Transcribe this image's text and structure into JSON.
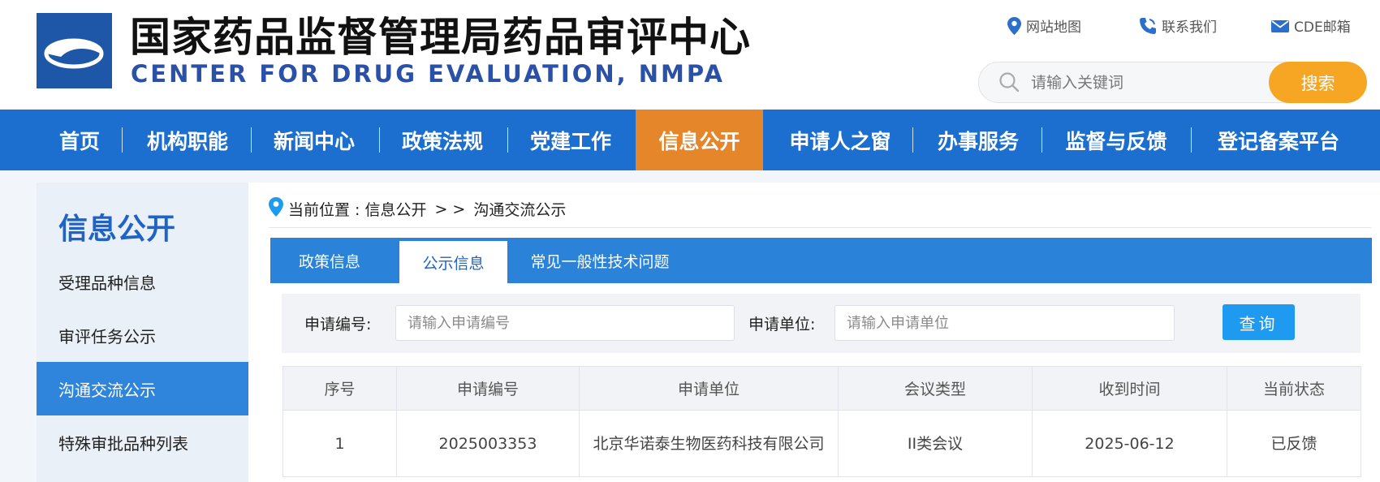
{
  "header": {
    "site_title": "国家药品监督管理局药品审评中心",
    "site_subtitle": "CENTER FOR DRUG EVALUATION, NMPA",
    "top_links": [
      {
        "label": "网站地图",
        "icon": "map-pin-icon"
      },
      {
        "label": "联系我们",
        "icon": "phone-icon"
      },
      {
        "label": "CDE邮箱",
        "icon": "mail-icon"
      }
    ],
    "search": {
      "placeholder": "请输入关键词",
      "value": "",
      "button_label": "搜索"
    }
  },
  "nav": {
    "items": [
      "首页",
      "机构职能",
      "新闻中心",
      "政策法规",
      "党建工作",
      "信息公开",
      "申请人之窗",
      "办事服务",
      "监督与反馈",
      "登记备案平台"
    ],
    "active": "信息公开"
  },
  "sidebar": {
    "title": "信息公开",
    "items": [
      "受理品种信息",
      "审评任务公示",
      "沟通交流公示",
      "特殊审批品种列表"
    ],
    "active": "沟通交流公示"
  },
  "breadcrumb": {
    "prefix": "当前位置 : ",
    "section": "信息公开",
    "separator": ">  >",
    "current": "沟通交流公示"
  },
  "tabs": {
    "items": [
      "政策信息",
      "公示信息",
      "常见一般性技术问题"
    ],
    "active": "公示信息"
  },
  "filter": {
    "app_no_label": "申请编号:",
    "app_no_placeholder": "请输入申请编号",
    "applicant_label": "申请单位:",
    "applicant_placeholder": "请输入申请单位",
    "query_button": "查询"
  },
  "table": {
    "columns": [
      "序号",
      "申请编号",
      "申请单位",
      "会议类型",
      "收到时间",
      "当前状态"
    ],
    "rows": [
      [
        "1",
        "2025003353",
        "北京华诺泰生物医药科技有限公司",
        "II类会议",
        "2025-06-12",
        "已反馈"
      ]
    ]
  },
  "colors": {
    "nav_bg": "#1c6fce",
    "nav_active": "#e5862a",
    "search_button": "#f6a623",
    "accent_blue": "#1f63c4",
    "query_button": "#1e9af0"
  }
}
